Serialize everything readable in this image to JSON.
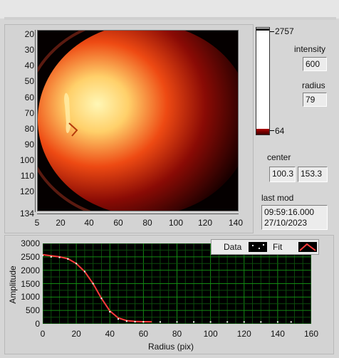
{
  "image_panel": {
    "y_ticks": [
      "20",
      "30",
      "40",
      "50",
      "60",
      "70",
      "80",
      "90",
      "100",
      "110",
      "120",
      "134"
    ],
    "x_ticks": [
      "5",
      "20",
      "40",
      "60",
      "80",
      "100",
      "120",
      "140"
    ]
  },
  "colorbar": {
    "max_label": "2757",
    "min_label": "64"
  },
  "intensity": {
    "label": "intensity",
    "value": "600"
  },
  "radius": {
    "label": "radius",
    "value": "79"
  },
  "center": {
    "label": "center",
    "x_value": "100.3",
    "y_value": "153.3"
  },
  "last_mod": {
    "label": "last mod",
    "time": "09:59:16.000",
    "date": "27/10/2023"
  },
  "chart_data": {
    "type": "scatter",
    "xlabel": "Radius (pix)",
    "ylabel": "Amplitude",
    "xlim": [
      0,
      160
    ],
    "ylim": [
      0,
      3000
    ],
    "x_ticks": [
      "0",
      "20",
      "40",
      "60",
      "80",
      "100",
      "120",
      "140",
      "160"
    ],
    "y_ticks": [
      "0",
      "500",
      "1000",
      "1500",
      "2000",
      "2500",
      "3000"
    ],
    "grid": true,
    "legend": {
      "placement": "top-right",
      "entries": [
        "Data",
        "Fit"
      ]
    },
    "series": [
      {
        "name": "Data",
        "x": [
          0,
          5,
          10,
          15,
          20,
          25,
          30,
          35,
          40,
          45,
          50,
          55,
          60,
          70,
          80,
          90,
          100,
          110,
          120,
          130,
          140,
          148
        ],
        "values": [
          2550,
          2500,
          2480,
          2420,
          2250,
          1950,
          1500,
          950,
          450,
          180,
          100,
          80,
          75,
          70,
          70,
          70,
          70,
          70,
          70,
          70,
          70,
          70
        ]
      },
      {
        "name": "Fit",
        "x": [
          0,
          10,
          15,
          20,
          25,
          30,
          35,
          40,
          45,
          50,
          55,
          60,
          65
        ],
        "values": [
          2580,
          2500,
          2430,
          2250,
          1950,
          1500,
          950,
          480,
          220,
          120,
          90,
          80,
          75
        ]
      }
    ]
  }
}
